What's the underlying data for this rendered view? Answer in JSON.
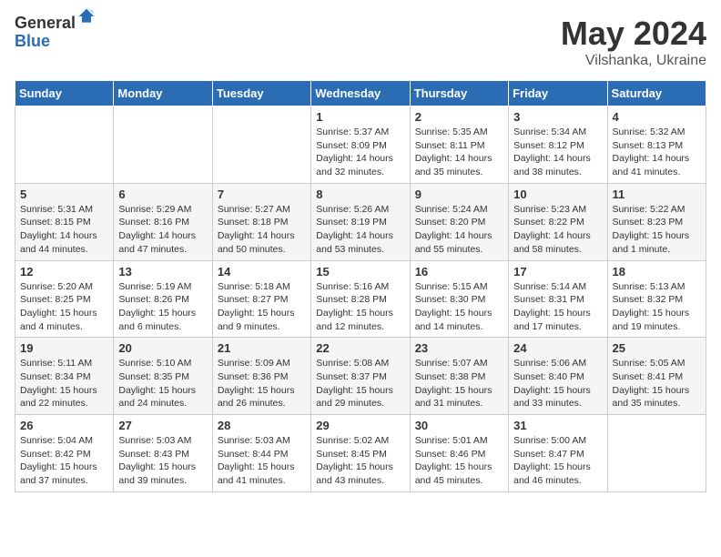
{
  "logo": {
    "general": "General",
    "blue": "Blue"
  },
  "title": "May 2024",
  "subtitle": "Vilshanka, Ukraine",
  "days_of_week": [
    "Sunday",
    "Monday",
    "Tuesday",
    "Wednesday",
    "Thursday",
    "Friday",
    "Saturday"
  ],
  "weeks": [
    [
      {
        "day": "",
        "sunrise": "",
        "sunset": "",
        "daylight": ""
      },
      {
        "day": "",
        "sunrise": "",
        "sunset": "",
        "daylight": ""
      },
      {
        "day": "",
        "sunrise": "",
        "sunset": "",
        "daylight": ""
      },
      {
        "day": "1",
        "sunrise": "Sunrise: 5:37 AM",
        "sunset": "Sunset: 8:09 PM",
        "daylight": "Daylight: 14 hours and 32 minutes."
      },
      {
        "day": "2",
        "sunrise": "Sunrise: 5:35 AM",
        "sunset": "Sunset: 8:11 PM",
        "daylight": "Daylight: 14 hours and 35 minutes."
      },
      {
        "day": "3",
        "sunrise": "Sunrise: 5:34 AM",
        "sunset": "Sunset: 8:12 PM",
        "daylight": "Daylight: 14 hours and 38 minutes."
      },
      {
        "day": "4",
        "sunrise": "Sunrise: 5:32 AM",
        "sunset": "Sunset: 8:13 PM",
        "daylight": "Daylight: 14 hours and 41 minutes."
      }
    ],
    [
      {
        "day": "5",
        "sunrise": "Sunrise: 5:31 AM",
        "sunset": "Sunset: 8:15 PM",
        "daylight": "Daylight: 14 hours and 44 minutes."
      },
      {
        "day": "6",
        "sunrise": "Sunrise: 5:29 AM",
        "sunset": "Sunset: 8:16 PM",
        "daylight": "Daylight: 14 hours and 47 minutes."
      },
      {
        "day": "7",
        "sunrise": "Sunrise: 5:27 AM",
        "sunset": "Sunset: 8:18 PM",
        "daylight": "Daylight: 14 hours and 50 minutes."
      },
      {
        "day": "8",
        "sunrise": "Sunrise: 5:26 AM",
        "sunset": "Sunset: 8:19 PM",
        "daylight": "Daylight: 14 hours and 53 minutes."
      },
      {
        "day": "9",
        "sunrise": "Sunrise: 5:24 AM",
        "sunset": "Sunset: 8:20 PM",
        "daylight": "Daylight: 14 hours and 55 minutes."
      },
      {
        "day": "10",
        "sunrise": "Sunrise: 5:23 AM",
        "sunset": "Sunset: 8:22 PM",
        "daylight": "Daylight: 14 hours and 58 minutes."
      },
      {
        "day": "11",
        "sunrise": "Sunrise: 5:22 AM",
        "sunset": "Sunset: 8:23 PM",
        "daylight": "Daylight: 15 hours and 1 minute."
      }
    ],
    [
      {
        "day": "12",
        "sunrise": "Sunrise: 5:20 AM",
        "sunset": "Sunset: 8:25 PM",
        "daylight": "Daylight: 15 hours and 4 minutes."
      },
      {
        "day": "13",
        "sunrise": "Sunrise: 5:19 AM",
        "sunset": "Sunset: 8:26 PM",
        "daylight": "Daylight: 15 hours and 6 minutes."
      },
      {
        "day": "14",
        "sunrise": "Sunrise: 5:18 AM",
        "sunset": "Sunset: 8:27 PM",
        "daylight": "Daylight: 15 hours and 9 minutes."
      },
      {
        "day": "15",
        "sunrise": "Sunrise: 5:16 AM",
        "sunset": "Sunset: 8:28 PM",
        "daylight": "Daylight: 15 hours and 12 minutes."
      },
      {
        "day": "16",
        "sunrise": "Sunrise: 5:15 AM",
        "sunset": "Sunset: 8:30 PM",
        "daylight": "Daylight: 15 hours and 14 minutes."
      },
      {
        "day": "17",
        "sunrise": "Sunrise: 5:14 AM",
        "sunset": "Sunset: 8:31 PM",
        "daylight": "Daylight: 15 hours and 17 minutes."
      },
      {
        "day": "18",
        "sunrise": "Sunrise: 5:13 AM",
        "sunset": "Sunset: 8:32 PM",
        "daylight": "Daylight: 15 hours and 19 minutes."
      }
    ],
    [
      {
        "day": "19",
        "sunrise": "Sunrise: 5:11 AM",
        "sunset": "Sunset: 8:34 PM",
        "daylight": "Daylight: 15 hours and 22 minutes."
      },
      {
        "day": "20",
        "sunrise": "Sunrise: 5:10 AM",
        "sunset": "Sunset: 8:35 PM",
        "daylight": "Daylight: 15 hours and 24 minutes."
      },
      {
        "day": "21",
        "sunrise": "Sunrise: 5:09 AM",
        "sunset": "Sunset: 8:36 PM",
        "daylight": "Daylight: 15 hours and 26 minutes."
      },
      {
        "day": "22",
        "sunrise": "Sunrise: 5:08 AM",
        "sunset": "Sunset: 8:37 PM",
        "daylight": "Daylight: 15 hours and 29 minutes."
      },
      {
        "day": "23",
        "sunrise": "Sunrise: 5:07 AM",
        "sunset": "Sunset: 8:38 PM",
        "daylight": "Daylight: 15 hours and 31 minutes."
      },
      {
        "day": "24",
        "sunrise": "Sunrise: 5:06 AM",
        "sunset": "Sunset: 8:40 PM",
        "daylight": "Daylight: 15 hours and 33 minutes."
      },
      {
        "day": "25",
        "sunrise": "Sunrise: 5:05 AM",
        "sunset": "Sunset: 8:41 PM",
        "daylight": "Daylight: 15 hours and 35 minutes."
      }
    ],
    [
      {
        "day": "26",
        "sunrise": "Sunrise: 5:04 AM",
        "sunset": "Sunset: 8:42 PM",
        "daylight": "Daylight: 15 hours and 37 minutes."
      },
      {
        "day": "27",
        "sunrise": "Sunrise: 5:03 AM",
        "sunset": "Sunset: 8:43 PM",
        "daylight": "Daylight: 15 hours and 39 minutes."
      },
      {
        "day": "28",
        "sunrise": "Sunrise: 5:03 AM",
        "sunset": "Sunset: 8:44 PM",
        "daylight": "Daylight: 15 hours and 41 minutes."
      },
      {
        "day": "29",
        "sunrise": "Sunrise: 5:02 AM",
        "sunset": "Sunset: 8:45 PM",
        "daylight": "Daylight: 15 hours and 43 minutes."
      },
      {
        "day": "30",
        "sunrise": "Sunrise: 5:01 AM",
        "sunset": "Sunset: 8:46 PM",
        "daylight": "Daylight: 15 hours and 45 minutes."
      },
      {
        "day": "31",
        "sunrise": "Sunrise: 5:00 AM",
        "sunset": "Sunset: 8:47 PM",
        "daylight": "Daylight: 15 hours and 46 minutes."
      },
      {
        "day": "",
        "sunrise": "",
        "sunset": "",
        "daylight": ""
      }
    ]
  ]
}
